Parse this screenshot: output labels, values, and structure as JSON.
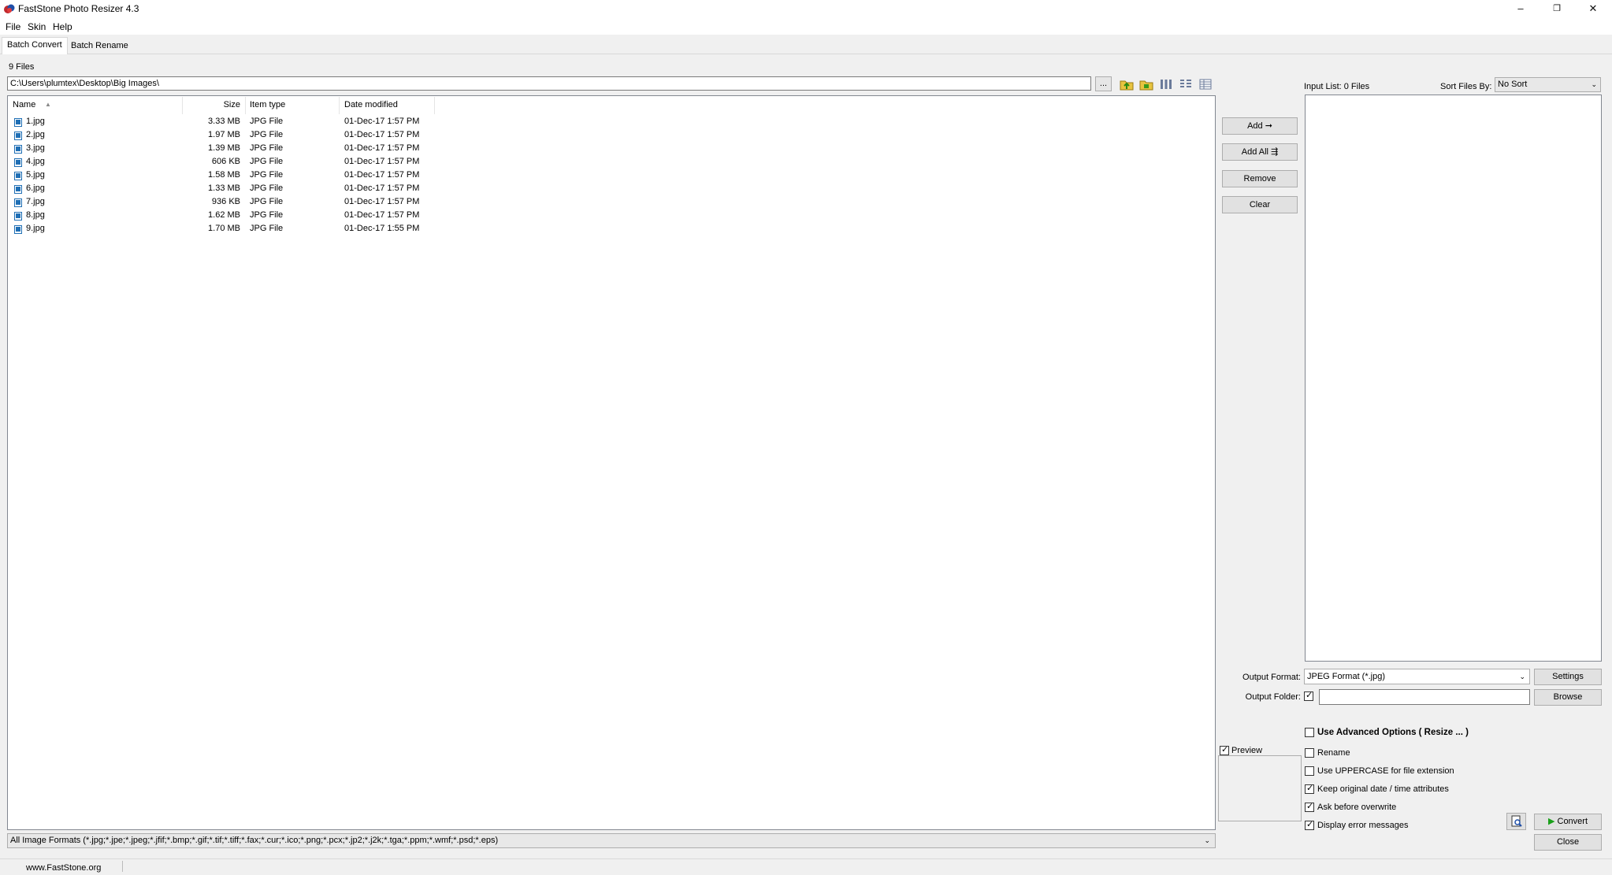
{
  "window": {
    "title": "FastStone Photo Resizer 4.3",
    "controls": [
      "–",
      "❐",
      "✕"
    ]
  },
  "menu": [
    "File",
    "Skin",
    "Help"
  ],
  "tabs": [
    "Batch Convert",
    "Batch Rename"
  ],
  "files_count": "9 Files",
  "path": "C:\\Users\\plumtex\\Desktop\\Big Images\\",
  "browse_dots": "...",
  "columns": {
    "name": "Name",
    "size": "Size",
    "type": "Item type",
    "date": "Date modified"
  },
  "files": [
    {
      "name": "1.jpg",
      "size": "3.33 MB",
      "type": "JPG File",
      "date": "01-Dec-17 1:57 PM"
    },
    {
      "name": "2.jpg",
      "size": "1.97 MB",
      "type": "JPG File",
      "date": "01-Dec-17 1:57 PM"
    },
    {
      "name": "3.jpg",
      "size": "1.39 MB",
      "type": "JPG File",
      "date": "01-Dec-17 1:57 PM"
    },
    {
      "name": "4.jpg",
      "size": "606 KB",
      "type": "JPG File",
      "date": "01-Dec-17 1:57 PM"
    },
    {
      "name": "5.jpg",
      "size": "1.58 MB",
      "type": "JPG File",
      "date": "01-Dec-17 1:57 PM"
    },
    {
      "name": "6.jpg",
      "size": "1.33 MB",
      "type": "JPG File",
      "date": "01-Dec-17 1:57 PM"
    },
    {
      "name": "7.jpg",
      "size": "936 KB",
      "type": "JPG File",
      "date": "01-Dec-17 1:57 PM"
    },
    {
      "name": "8.jpg",
      "size": "1.62 MB",
      "type": "JPG File",
      "date": "01-Dec-17 1:57 PM"
    },
    {
      "name": "9.jpg",
      "size": "1.70 MB",
      "type": "JPG File",
      "date": "01-Dec-17 1:55 PM"
    }
  ],
  "buttons": {
    "add": "Add",
    "add_all": "Add All",
    "remove": "Remove",
    "clear": "Clear",
    "settings": "Settings",
    "browse": "Browse",
    "convert": "Convert",
    "close": "Close"
  },
  "input_list": {
    "label": "Input List:  0 Files",
    "sort_label": "Sort Files By:",
    "sort_value": "No Sort"
  },
  "output": {
    "format_label": "Output Format:",
    "format_value": "JPEG Format (*.jpg)",
    "folder_label": "Output Folder:",
    "folder_checked": true,
    "folder_value": ""
  },
  "options": [
    {
      "label": "Use Advanced Options ( Resize ... )",
      "checked": false,
      "bold": true
    },
    {
      "label": "Rename",
      "checked": false
    },
    {
      "label": "Use UPPERCASE for file extension",
      "checked": false
    },
    {
      "label": "Keep original date / time attributes",
      "checked": true
    },
    {
      "label": "Ask before overwrite",
      "checked": true
    },
    {
      "label": "Display error messages",
      "checked": true
    }
  ],
  "preview": {
    "label": "Preview",
    "checked": true
  },
  "filter": "All Image Formats (*.jpg;*.jpe;*.jpeg;*.jfif;*.bmp;*.gif;*.tif;*.tiff;*.fax;*.cur;*.ico;*.png;*.pcx;*.jp2;*.j2k;*.tga;*.ppm;*.wmf;*.psd;*.eps)",
  "status": {
    "url": "www.FastStone.org"
  },
  "colors": {
    "folder_icon": "#3a9a1a",
    "convert_arrow": "#1aa01a",
    "file_icon": "#1f6fb5"
  }
}
